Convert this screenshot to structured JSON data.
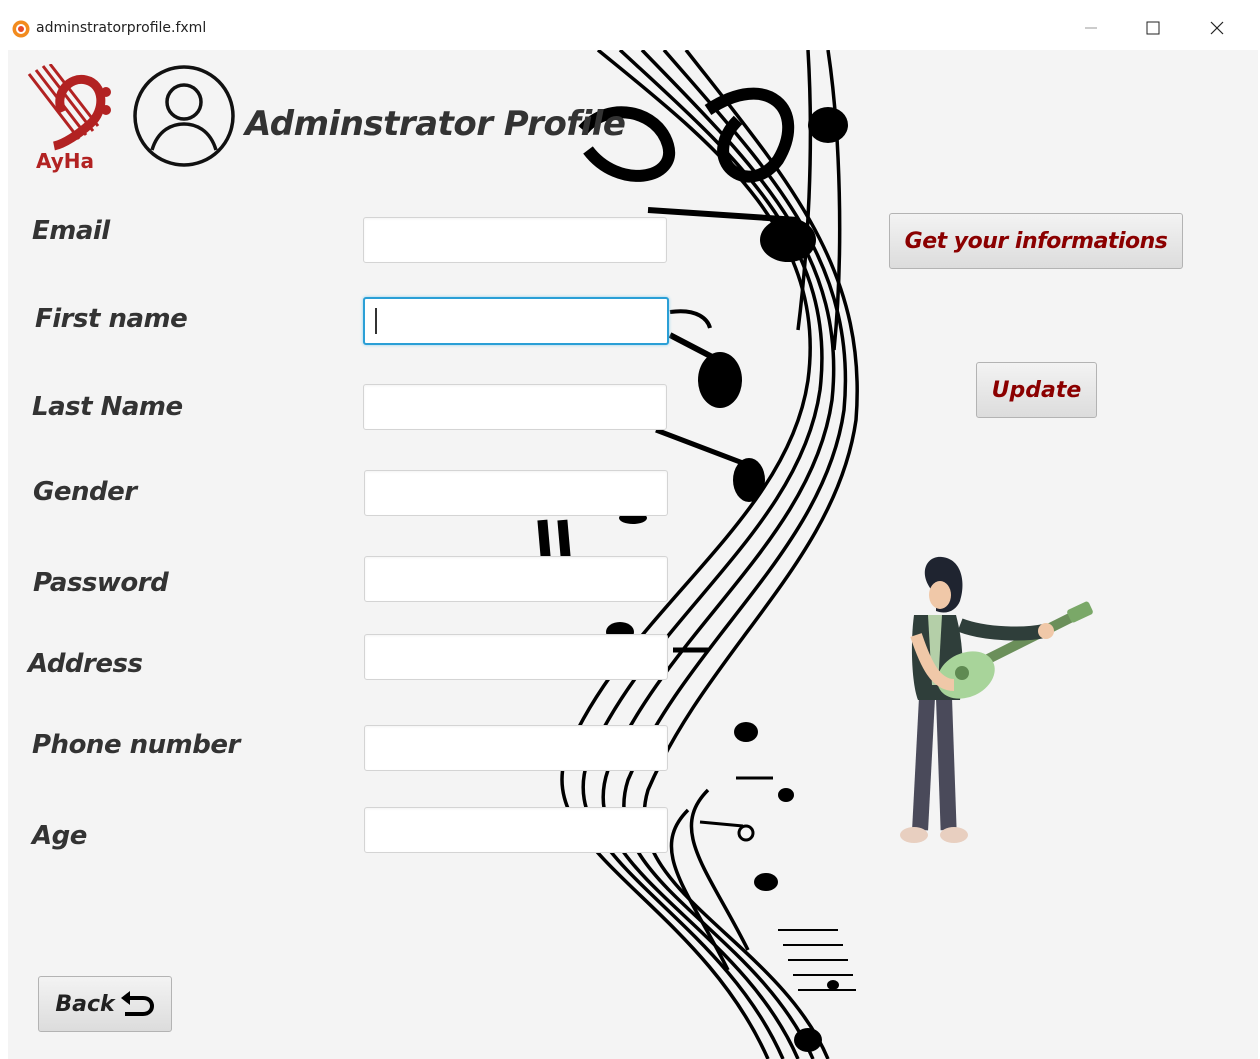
{
  "window": {
    "title": "adminstratorprofile.fxml",
    "controls": [
      "minimize",
      "maximize",
      "close"
    ]
  },
  "header": {
    "logo_text": "AyHa",
    "title": "Adminstrator Profile"
  },
  "form": {
    "fields": [
      {
        "label": "Email",
        "value": ""
      },
      {
        "label": "First name",
        "value": "",
        "focused": true
      },
      {
        "label": "Last Name",
        "value": ""
      },
      {
        "label": "Gender",
        "value": ""
      },
      {
        "label": "Password",
        "value": ""
      },
      {
        "label": "Address",
        "value": ""
      },
      {
        "label": "Phone number",
        "value": ""
      },
      {
        "label": "Age",
        "value": ""
      }
    ]
  },
  "buttons": {
    "get_info": "Get your informations",
    "update": "Update",
    "back": "Back"
  },
  "colors": {
    "button_text": "#8b0000",
    "logo": "#b22222",
    "focus_border": "#2a9fd6",
    "background": "#f4f4f4"
  }
}
